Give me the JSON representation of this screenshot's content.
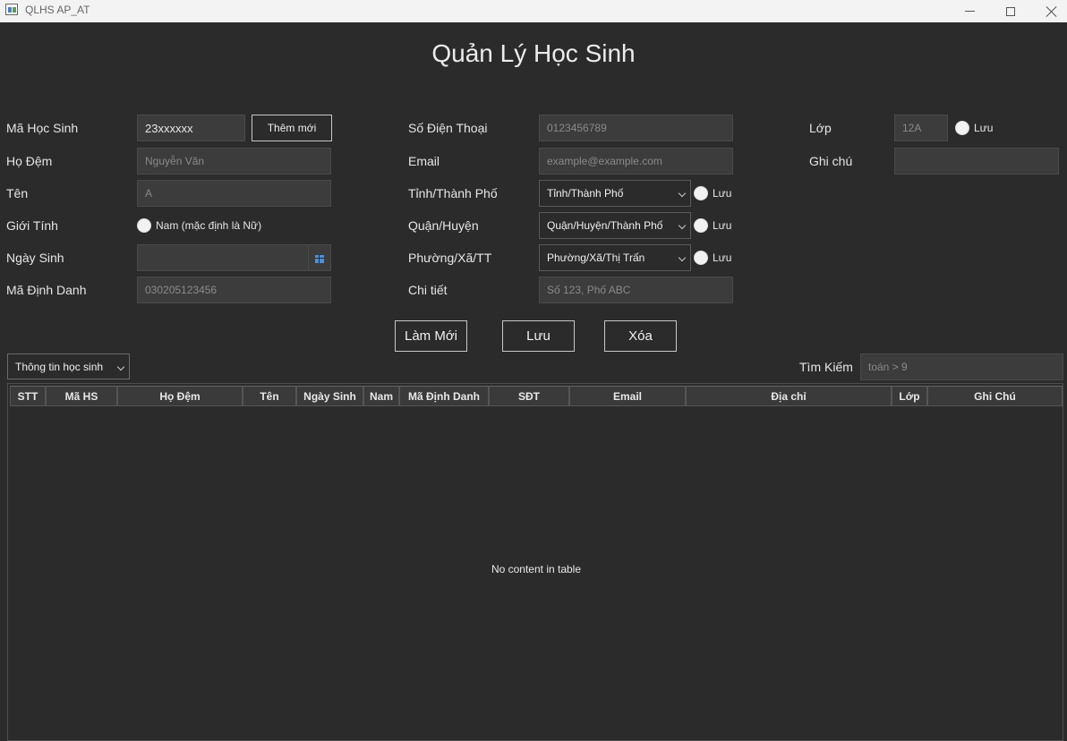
{
  "window": {
    "title": "QLHS AP_AT"
  },
  "page_title": "Quản Lý Học Sinh",
  "left": {
    "ma_hs_label": "Mã Học Sinh",
    "ma_hs_value": "23xxxxxx",
    "them_moi": "Thêm mới",
    "ho_dem_label": "Họ Đệm",
    "ho_dem_placeholder": "Nguyễn Văn",
    "ten_label": "Tên",
    "ten_placeholder": "A",
    "gioi_tinh_label": "Giới Tính",
    "gioi_tinh_radio": "Nam (mặc định là Nữ)",
    "ngay_sinh_label": "Ngày Sinh",
    "ma_dinh_danh_label": "Mã Định Danh",
    "ma_dinh_danh_placeholder": "030205123456"
  },
  "middle": {
    "sdt_label": "Số Điện Thoại",
    "sdt_placeholder": "0123456789",
    "email_label": "Email",
    "email_placeholder": "example@example.com",
    "tinh_label": "Tỉnh/Thành Phố",
    "tinh_value": "Tỉnh/Thành Phố",
    "quan_label": "Quận/Huyện",
    "quan_value": "Quận/Huyện/Thành Phố",
    "phuong_label": "Phường/Xã/TT",
    "phuong_value": "Phường/Xã/Thị Trấn",
    "chi_tiet_label": "Chi tiết",
    "chi_tiet_placeholder": "Số 123, Phố ABC",
    "luu": "Lưu"
  },
  "right": {
    "lop_label": "Lớp",
    "lop_placeholder": "12A",
    "luu": "Lưu",
    "ghi_chu_label": "Ghi chú"
  },
  "actions": {
    "lam_moi": "Làm Mới",
    "luu": "Lưu",
    "xoa": "Xóa"
  },
  "filter": {
    "view_select": "Thông tin học sinh",
    "search_label": "Tìm Kiếm",
    "search_placeholder": "toán > 9"
  },
  "table": {
    "columns": [
      "STT",
      "Mã HS",
      "Họ Đệm",
      "Tên",
      "Ngày Sinh",
      "Nam",
      "Mã Định Danh",
      "SĐT",
      "Email",
      "Địa chỉ",
      "Lớp",
      "Ghi Chú"
    ],
    "empty_text": "No content in table"
  }
}
